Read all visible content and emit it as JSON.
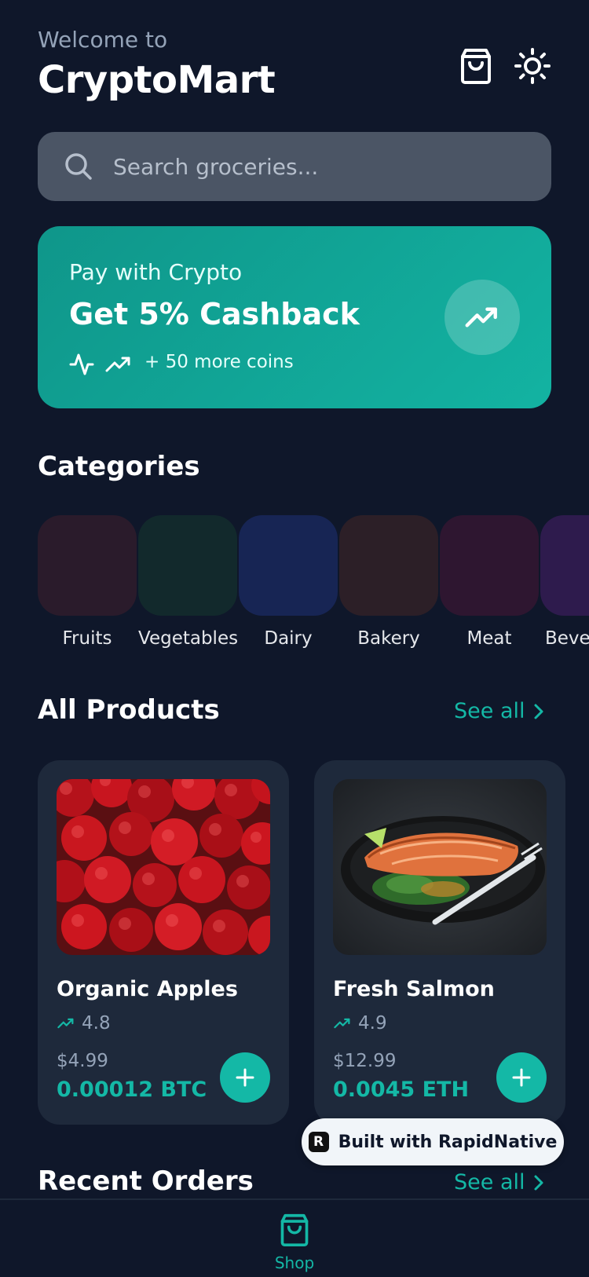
{
  "header": {
    "welcome": "Welcome to",
    "title": "CryptoMart",
    "cart_icon": "shopping-bag-icon",
    "theme_icon": "sun-icon"
  },
  "search": {
    "placeholder": "Search groceries..."
  },
  "promo": {
    "subtitle": "Pay with Crypto",
    "title": "Get 5% Cashback",
    "coins_text": "+ 50 more coins",
    "icons": [
      "activity-icon",
      "trending-up-icon"
    ]
  },
  "categories": {
    "title": "Categories",
    "items": [
      {
        "label": "Fruits",
        "color": "#2a1b2b"
      },
      {
        "label": "Vegetables",
        "color": "#12292c"
      },
      {
        "label": "Dairy",
        "color": "#172554"
      },
      {
        "label": "Bakery",
        "color": "#2c1f27"
      },
      {
        "label": "Meat",
        "color": "#2e1630"
      },
      {
        "label": "Beve",
        "color": "#2e1b4d"
      }
    ]
  },
  "products": {
    "title": "All Products",
    "see_all": "See all",
    "items": [
      {
        "name": "Organic Apples",
        "rating": "4.8",
        "price": "$4.99",
        "crypto_price": "0.00012 BTC"
      },
      {
        "name": "Fresh Salmon",
        "rating": "4.9",
        "price": "$12.99",
        "crypto_price": "0.0045 ETH"
      }
    ]
  },
  "recent_orders": {
    "title": "Recent Orders",
    "see_all": "See all"
  },
  "badge": {
    "text": "Built with RapidNative"
  },
  "tabbar": {
    "shop_label": "Shop"
  },
  "colors": {
    "background": "#0f172a",
    "accent": "#14b8a6",
    "card": "#1e293b"
  }
}
